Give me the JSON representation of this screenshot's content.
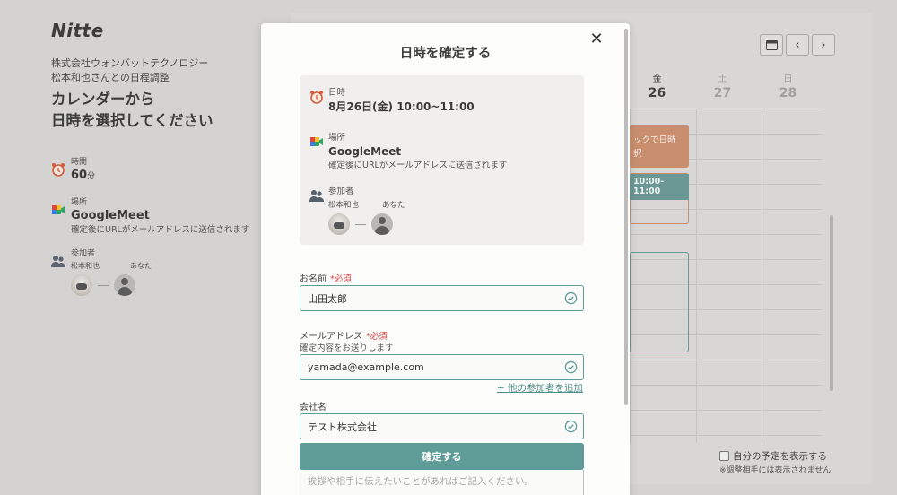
{
  "app": {
    "logo": "Nitte"
  },
  "sidebar": {
    "company_line": "株式会社ウォンバットテクノロジー",
    "person_line": "松本和也さんとの日程調整",
    "headline_1": "カレンダーから",
    "headline_2": "日時を選択してください",
    "duration_label": "時間",
    "duration_value": "60",
    "duration_unit": "分",
    "place_label": "場所",
    "place_value": "GoogleMeet",
    "place_note": "確定後にURLがメールアドレスに送信されます",
    "participants_label": "参加者",
    "participant_1": "松本和也",
    "participant_2": "あなた"
  },
  "calendar": {
    "columns": [
      {
        "dow": "金",
        "date": "26",
        "muted": false
      },
      {
        "dow": "土",
        "date": "27",
        "muted": true
      },
      {
        "dow": "日",
        "date": "28",
        "muted": true
      }
    ],
    "event_hint": "ックで日時\n択",
    "event_selected": "10:00-11:00",
    "own_schedule_label": "自分の予定を表示する",
    "own_schedule_note": "※調整相手には表示されません",
    "own_schedule_checked": false
  },
  "modal": {
    "title": "日時を確定する",
    "summary": {
      "datetime_label": "日時",
      "datetime_value": "8月26日(金) 10:00~11:00",
      "place_label": "場所",
      "place_value": "GoogleMeet",
      "place_note": "確定後にURLがメールアドレスに送信されます",
      "participants_label": "参加者",
      "participant_1": "松本和也",
      "participant_2": "あなた"
    },
    "form": {
      "name_label": "お名前",
      "name_required": "*必須",
      "name_value": "山田太郎",
      "email_label": "メールアドレス",
      "email_required": "*必須",
      "email_sub": "確定内容をお送りします",
      "email_value": "yamada@example.com",
      "add_participant": "+ 他の参加者を追加",
      "company_label": "会社名",
      "company_value": "テスト株式会社",
      "confirm_button": "確定する",
      "memo_placeholder": "挨拶や相手に伝えたいことがあればご記入ください。"
    }
  },
  "colors": {
    "accent": "#5f9b97",
    "required": "#d64545",
    "event_orange": "#c88e6e"
  }
}
